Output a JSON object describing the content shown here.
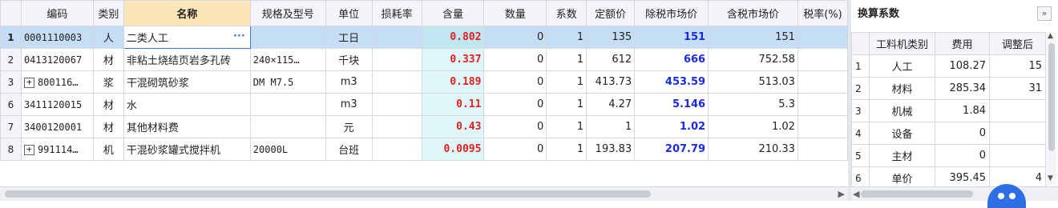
{
  "grid": {
    "headers": [
      "编码",
      "类别",
      "名称",
      "规格及型号",
      "单位",
      "损耗率",
      "含量",
      "数量",
      "系数",
      "定额价",
      "除税市场价",
      "含税市场价",
      "税率(%)"
    ],
    "rows": [
      {
        "rn": "1",
        "code": "0001110003",
        "tree": false,
        "cat": "人",
        "name": "二类人工",
        "spec": "",
        "unit": "工日",
        "loss": "",
        "qty": "0.802",
        "num": "0",
        "coef": "1",
        "quota": "135",
        "excl": "151",
        "incl": "151",
        "selected": true
      },
      {
        "rn": "2",
        "code": "0413120067",
        "tree": false,
        "cat": "材",
        "name": "非粘土烧结页岩多孔砖",
        "spec": "240×115…",
        "unit": "千块",
        "loss": "",
        "qty": "0.337",
        "num": "0",
        "coef": "1",
        "quota": "612",
        "excl": "666",
        "incl": "752.58"
      },
      {
        "rn": "3",
        "code": "800116…",
        "tree": true,
        "cat": "浆",
        "name": "干混砌筑砂浆",
        "spec": "DM M7.5",
        "unit": "m3",
        "loss": "",
        "qty": "0.189",
        "num": "0",
        "coef": "1",
        "quota": "413.73",
        "excl": "453.59",
        "incl": "513.03"
      },
      {
        "rn": "6",
        "code": "3411120015",
        "tree": false,
        "cat": "材",
        "name": "水",
        "spec": "",
        "unit": "m3",
        "loss": "",
        "qty": "0.11",
        "num": "0",
        "coef": "1",
        "quota": "4.27",
        "excl": "5.146",
        "incl": "5.3"
      },
      {
        "rn": "7",
        "code": "3400120001",
        "tree": false,
        "cat": "材",
        "name": "其他材料费",
        "spec": "",
        "unit": "元",
        "loss": "",
        "qty": "0.43",
        "num": "0",
        "coef": "1",
        "quota": "1",
        "excl": "1.02",
        "incl": "1.02"
      },
      {
        "rn": "8",
        "code": "991114…",
        "tree": true,
        "cat": "机",
        "name": "干混砂浆罐式搅拌机",
        "spec": "20000L",
        "unit": "台班",
        "loss": "",
        "qty": "0.0095",
        "num": "0",
        "coef": "1",
        "quota": "193.83",
        "excl": "207.79",
        "incl": "210.33"
      }
    ]
  },
  "panel": {
    "title": "换算系数",
    "headers": [
      "工料机类别",
      "费用",
      "调整后"
    ],
    "rows": [
      {
        "idx": "1",
        "cat": "人工",
        "fee": "108.27",
        "adj": "15"
      },
      {
        "idx": "2",
        "cat": "材料",
        "fee": "285.34",
        "adj": "31"
      },
      {
        "idx": "3",
        "cat": "机械",
        "fee": "1.84",
        "adj": ""
      },
      {
        "idx": "4",
        "cat": "设备",
        "fee": "0",
        "adj": ""
      },
      {
        "idx": "5",
        "cat": "主材",
        "fee": "0",
        "adj": ""
      },
      {
        "idx": "6",
        "cat": "单价",
        "fee": "395.45",
        "adj": "4"
      }
    ]
  },
  "icons": {
    "expand": "double-chevron-right-icon",
    "ellipsis": "ellipsis-icon",
    "tree": "expand-plus-icon",
    "assistant": "robot-assistant-icon"
  },
  "colors": {
    "qty_text": "#e02020",
    "price_blue": "#1a2be0",
    "selected_row": "#c6ddf6",
    "name_header": "#fbe6b8",
    "qty_cell": "#dff6f8"
  }
}
